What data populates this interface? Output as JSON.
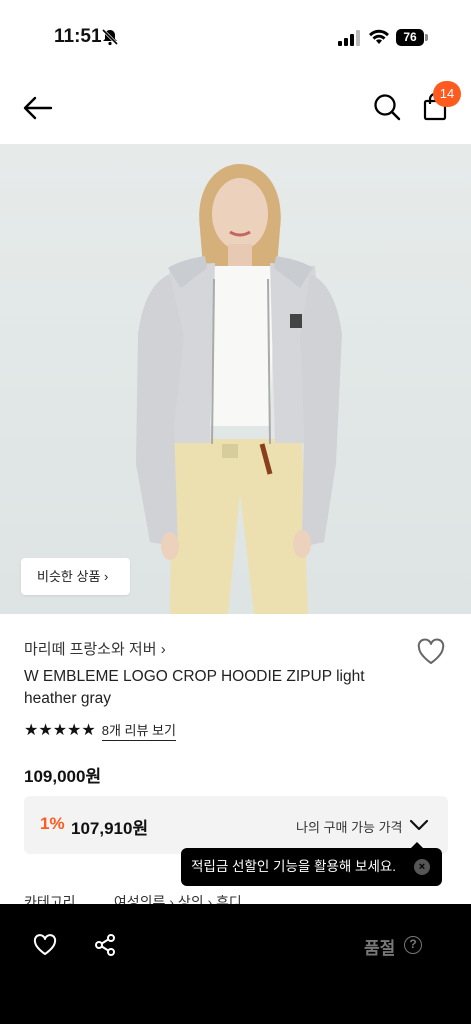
{
  "status_bar": {
    "time": "11:51",
    "battery": "76"
  },
  "header": {
    "cart_count": "14"
  },
  "hero": {
    "similar_button": "비슷한 상품 ›"
  },
  "product": {
    "brand": "마리떼 프랑소와 저버 ›",
    "name": "W EMBLEME LOGO CROP HOODIE ZIPUP light heather gray",
    "stars": "★★★★★",
    "rating_stars_filled": 5,
    "review_link": "8개 리뷰 보기",
    "price": "109,000원"
  },
  "my_price": {
    "percent": "1%",
    "value": "107,910원",
    "label": "나의 구매 가능 가격"
  },
  "tooltip": {
    "text": "적립금 선할인 기능을 활용해 보세요."
  },
  "category": {
    "label": "카테고리",
    "path": "여성의류 › 상의 › 후디"
  },
  "bottom_bar": {
    "soldout": "품절",
    "help": "?"
  },
  "colors": {
    "accent": "#ff5a1f",
    "bottom_bg": "#000000",
    "box_bg": "#f3f3f3"
  }
}
